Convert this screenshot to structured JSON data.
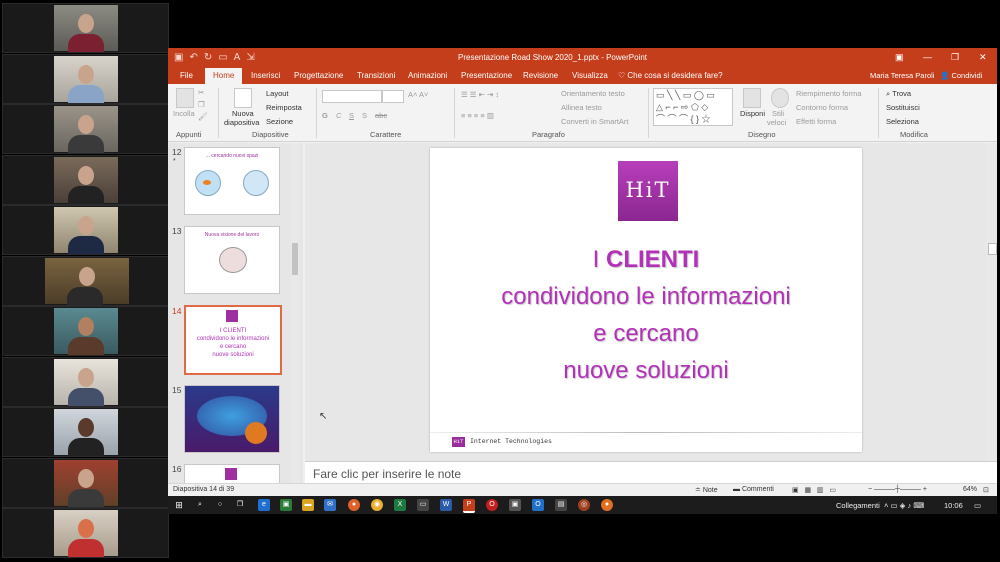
{
  "window": {
    "title": "Presentazione Road Show 2020_1.pptx - PowerPoint",
    "user": "Maria Teresa Paroli",
    "share_label": "Condividi"
  },
  "tabs": [
    "File",
    "Home",
    "Inserisci",
    "Progettazione",
    "Transizioni",
    "Animazioni",
    "Presentazione",
    "Revisione",
    "Visualizza"
  ],
  "tell_me": "Che cosa si desidera fare?",
  "ribbon": {
    "appunti": {
      "label": "Appunti",
      "paste": "Incolla"
    },
    "diapositive": {
      "label": "Diapositive",
      "new_slide": "Nuova",
      "new_slide2": "diapositiva",
      "layout": "Layout",
      "reset": "Reimposta",
      "section": "Sezione"
    },
    "carattere": {
      "label": "Carattere",
      "bold": "G",
      "italic": "C",
      "underline": "S",
      "strike": "S",
      "shadow": "abc"
    },
    "paragrafo": {
      "label": "Paragrafo",
      "text_direction": "Orientamento testo",
      "align_text": "Allinea testo",
      "convert": "Converti in SmartArt"
    },
    "disegno": {
      "label": "Disegno",
      "arrange": "Disponi",
      "quick_styles": "Stili",
      "quick_styles2": "veloci",
      "fill": "Riempimento forma",
      "outline": "Contorno forma",
      "effects": "Effetti forma"
    },
    "modifica": {
      "label": "Modifica",
      "find": "Trova",
      "replace": "Sostituisci",
      "select": "Seleziona"
    }
  },
  "slides": [
    {
      "num": "12",
      "title": "... cercando nuovi spazi",
      "star": "*"
    },
    {
      "num": "13",
      "title": "Nuova visione del lavoro"
    },
    {
      "num": "14",
      "line1": "I CLIENTI",
      "line2": "condividono le informazioni",
      "line3": "e cercano",
      "line4": "nuove soluzioni"
    },
    {
      "num": "15"
    },
    {
      "num": "16"
    }
  ],
  "current_slide": {
    "logo_text": "HiT",
    "line1_prefix": "I ",
    "line1_bold": "CLIENTI",
    "line2": "condividono le informazioni",
    "line3": "e cercano",
    "line4": "nuove soluzioni",
    "footer_logo": "HiT",
    "footer_text": "Internet Technologies"
  },
  "notes_placeholder": "Fare clic per inserire le note",
  "status": {
    "slide_count": "Diapositiva 14 di 39",
    "notes": "Note",
    "comments": "Commenti",
    "zoom": "64%"
  },
  "taskbar": {
    "network": "Collegamenti",
    "time": "10:06"
  },
  "colors": {
    "accent": "#c43e1c",
    "slide_text": "#b331b8",
    "logo": "#9b2c9e"
  }
}
